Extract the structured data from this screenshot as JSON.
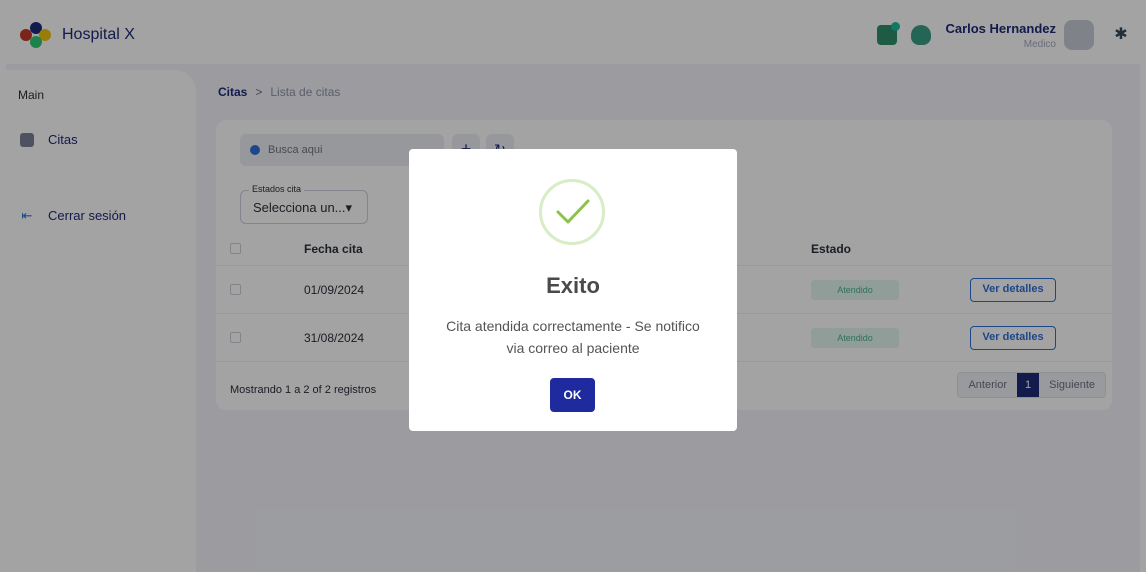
{
  "header": {
    "app_name": "Hospital X",
    "user_name": "Carlos Hernandez",
    "user_role": "Medico"
  },
  "sidebar": {
    "section": "Main",
    "items": [
      {
        "label": "Citas",
        "icon": "calendar-icon"
      },
      {
        "label": "Cerrar sesión",
        "icon": "logout-icon"
      }
    ]
  },
  "breadcrumb": {
    "root": "Citas",
    "separator": ">",
    "leaf": "Lista de citas"
  },
  "toolbar": {
    "search_placeholder": "Busca aqui",
    "add_label": "+",
    "refresh_label": "↻"
  },
  "filter": {
    "label": "Estados cita",
    "value": "Selecciona un...▾"
  },
  "table": {
    "headers": {
      "fecha": "Fecha cita",
      "estado": "Estado"
    },
    "rows": [
      {
        "fecha": "01/09/2024",
        "estado": "Atendido",
        "action": "Ver detalles"
      },
      {
        "fecha": "31/08/2024",
        "estado": "Atendido",
        "action": "Ver detalles"
      }
    ]
  },
  "pagination": {
    "info": "Mostrando 1 a 2 of 2 registros",
    "prev": "Anterior",
    "current": "1",
    "next": "Siguiente"
  },
  "modal": {
    "title": "Exito",
    "message": "Cita atendida correctamente - Se notifico via correo al paciente",
    "ok_label": "OK"
  },
  "colors": {
    "brand": "#1e2a78",
    "accent": "#2e6fd6",
    "success_badge_bg": "#e3f6ee",
    "success_badge_text": "#49b58a",
    "check": "#8bc34a"
  }
}
